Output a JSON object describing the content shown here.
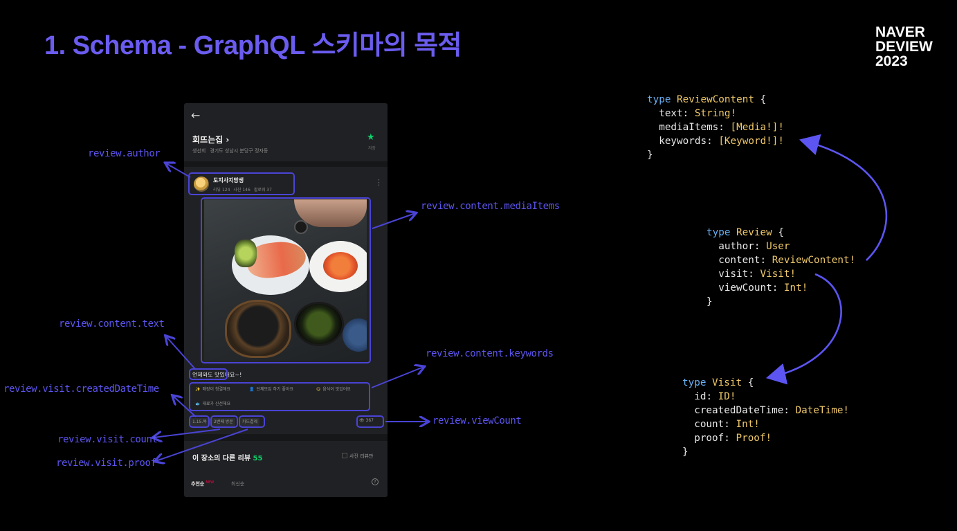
{
  "slide": {
    "title": "1. Schema - GraphQL 스키마의 목적",
    "brand": [
      "NAVER",
      "DEVIEW",
      "2023"
    ]
  },
  "phone": {
    "back_icon": "←",
    "place_name": "회뜨는집 ›",
    "place_category": "생선회",
    "place_address": "경기도 성남시 분당구 정자동",
    "fav_icon": "★",
    "fav_label": "저장",
    "author_name": "도지사지망생",
    "author_stats": [
      "리뷰 124",
      "사진 146",
      "팔로워 37"
    ],
    "more_icon": "⋮",
    "review_text": "언제와도 맛있어요~!",
    "keywords": [
      {
        "icon": "✨",
        "label": "매장이 청결해요"
      },
      {
        "icon": "👤",
        "label": "단체모임 하기 좋아요"
      },
      {
        "icon": "😋",
        "label": "음식이 맛있어요"
      },
      {
        "icon": "🐟",
        "label": "재료가 신선해요"
      }
    ],
    "visit_date": "1.15.목",
    "visit_count": "2번째 방문",
    "visit_proof": "카드결제",
    "view_icon": "👁",
    "view_count": "367",
    "others_title": "이 장소의 다른 리뷰",
    "others_count": "55",
    "photo_only_label": "사진 리뷰만",
    "sort_recommended": "추천순",
    "sort_new_badge": "NEW",
    "sort_latest": "최신순",
    "help_icon": "?"
  },
  "annotations": {
    "author": "review.author",
    "media_items": "review.content.mediaItems",
    "content_text": "review.content.text",
    "keywords": "review.content.keywords",
    "created_date_time": "review.visit.createdDateTime",
    "view_count": "review.viewCount",
    "visit_count": "review.visit.count",
    "visit_proof": "review.visit.proof"
  },
  "schema": {
    "review_content": {
      "name": "ReviewContent",
      "fields": [
        {
          "name": "text",
          "type": "String!"
        },
        {
          "name": "mediaItems",
          "type": "[Media!]!"
        },
        {
          "name": "keywords",
          "type": "[Keyword!]!"
        }
      ]
    },
    "review": {
      "name": "Review",
      "fields": [
        {
          "name": "author",
          "type": "User"
        },
        {
          "name": "content",
          "type": "ReviewContent!"
        },
        {
          "name": "visit",
          "type": "Visit!"
        },
        {
          "name": "viewCount",
          "type": "Int!"
        }
      ]
    },
    "visit": {
      "name": "Visit",
      "fields": [
        {
          "name": "id",
          "type": "ID!"
        },
        {
          "name": "createdDateTime",
          "type": "DateTime!"
        },
        {
          "name": "count",
          "type": "Int!"
        },
        {
          "name": "proof",
          "type": "Proof!"
        }
      ]
    }
  },
  "colors": {
    "title": "#6b5cf0",
    "annotation": "#5d55f2",
    "keyword": "#6ab0f3",
    "type_name": "#f0c96a",
    "accent_green": "#0bd36a"
  }
}
